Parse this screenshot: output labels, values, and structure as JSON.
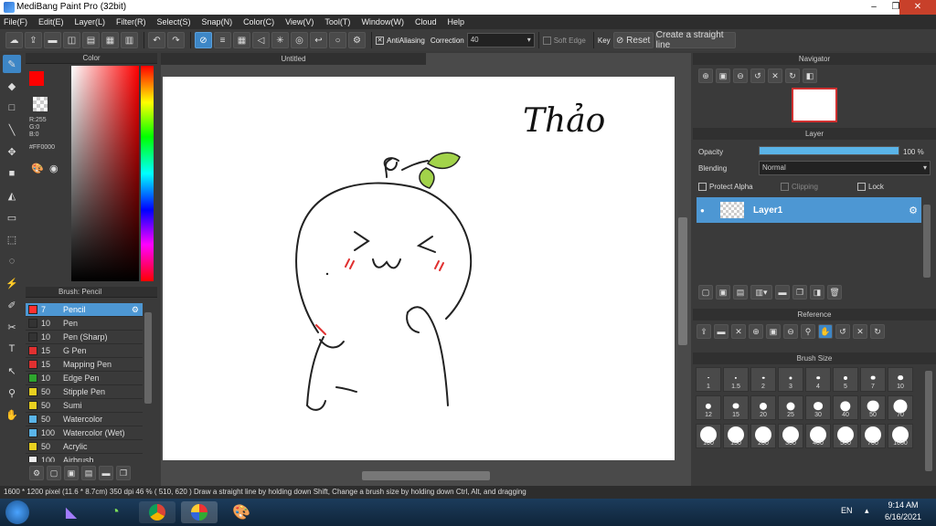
{
  "app": {
    "title": "MediBang Paint Pro (32bit)"
  },
  "menu": [
    "File(F)",
    "Edit(E)",
    "Layer(L)",
    "Filter(R)",
    "Select(S)",
    "Snap(N)",
    "Color(C)",
    "View(V)",
    "Tool(T)",
    "Window(W)",
    "Cloud",
    "Help"
  ],
  "toolbar": {
    "antialiasing": "AntiAliasing",
    "correction_label": "Correction",
    "correction_value": "40",
    "soft_edge": "Soft Edge",
    "key": "Key",
    "reset": "Reset",
    "straight_line": "Create a straight line"
  },
  "color": {
    "title": "Color",
    "r": "R:255",
    "g": "G:0",
    "b": "B:0",
    "hex": "#FF0000",
    "current": "#ff0000"
  },
  "brush": {
    "title": "Brush: Pencil",
    "items": [
      {
        "size": "7",
        "name": "Pencil",
        "color": "#ff3030",
        "selected": true
      },
      {
        "size": "10",
        "name": "Pen",
        "color": "#333333"
      },
      {
        "size": "10",
        "name": "Pen (Sharp)",
        "color": "#333333"
      },
      {
        "size": "15",
        "name": "G Pen",
        "color": "#e03030"
      },
      {
        "size": "15",
        "name": "Mapping Pen",
        "color": "#e03030"
      },
      {
        "size": "10",
        "name": "Edge Pen",
        "color": "#2ea52e"
      },
      {
        "size": "50",
        "name": "Stipple Pen",
        "color": "#e8d020"
      },
      {
        "size": "50",
        "name": "Sumi",
        "color": "#e8d020"
      },
      {
        "size": "50",
        "name": "Watercolor",
        "color": "#5ab4e8"
      },
      {
        "size": "100",
        "name": "Watercolor (Wet)",
        "color": "#5ab4e8"
      },
      {
        "size": "50",
        "name": "Acrylic",
        "color": "#e8d020"
      },
      {
        "size": "100",
        "name": "Airbrush",
        "color": "#eeeeee"
      }
    ]
  },
  "canvas": {
    "tab": "Untitled",
    "handwriting": "Thảo"
  },
  "navigator": {
    "title": "Navigator"
  },
  "layer": {
    "title": "Layer",
    "opacity_label": "Opacity",
    "opacity_value": "100 %",
    "opacity_fraction": 1.0,
    "blending_label": "Blending",
    "blending_value": "Normal",
    "protect_alpha": "Protect Alpha",
    "clipping": "Clipping",
    "lock": "Lock",
    "layer_name": "Layer1"
  },
  "reference": {
    "title": "Reference"
  },
  "brush_size": {
    "title": "Brush Size",
    "sizes": [
      "1",
      "1.5",
      "2",
      "3",
      "4",
      "5",
      "7",
      "10",
      "12",
      "15",
      "20",
      "25",
      "30",
      "40",
      "50",
      "70",
      "100",
      "150",
      "200",
      "300",
      "400",
      "500",
      "700",
      "1000"
    ]
  },
  "status": {
    "text": "1600 * 1200 pixel   (11.6 * 8.7cm)   350 dpi   46 %   ( 510, 620 )   Draw a straight line by holding down Shift, Change a brush size by holding down Ctrl, Alt, and dragging"
  },
  "taskbar": {
    "lang": "EN",
    "time": "9:14 AM",
    "date": "6/16/2021"
  }
}
